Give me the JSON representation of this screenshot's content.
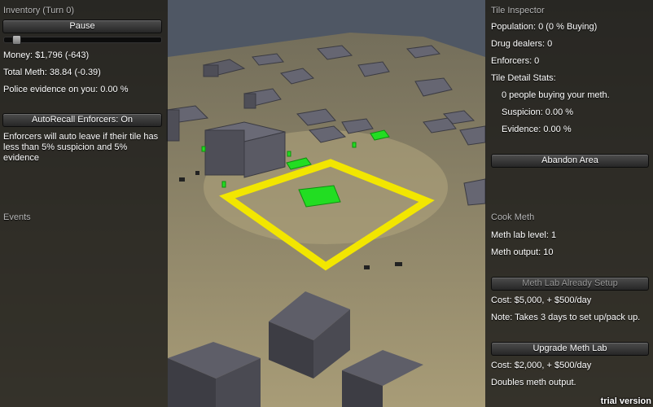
{
  "left": {
    "title": "Inventory (Turn 0)",
    "pause_label": "Pause",
    "money": "Money: $1,796 (-643)",
    "total_meth": "Total Meth: 38.84 (-0.39)",
    "police_evidence": "Police evidence on you: 0.00 %",
    "autorecall_label": "AutoRecall Enforcers: On",
    "autorecall_note": "Enforcers will auto leave if their tile has less than 5% suspicion and 5% evidence",
    "events_title": "Events",
    "speed_fraction": 0.05
  },
  "right": {
    "title": "Tile Inspector",
    "population": "Population: 0 (0 % Buying)",
    "drug_dealers": "Drug dealers: 0",
    "enforcers": "Enforcers: 0",
    "detail_title": "Tile Detail Stats:",
    "buying": "0 people buying your meth.",
    "suspicion": "Suspicion: 0.00 %",
    "evidence": "Evidence: 0.00 %",
    "abandon_label": "Abandon Area",
    "cook_title": "Cook Meth",
    "lab_level": "Meth lab level: 1",
    "lab_output": "Meth output: 10",
    "setup_label": "Meth Lab Already Setup",
    "setup_cost": "Cost: $5,000, + $500/day",
    "setup_note": "Note: Takes 3 days to set up/pack up.",
    "upgrade_label": "Upgrade Meth Lab",
    "upgrade_cost": "Cost: $2,000, + $500/day",
    "upgrade_note": "Doubles meth output."
  },
  "watermark": "trial version",
  "colors": {
    "selection": "#f2e600",
    "unit": "#22dd22",
    "ground": "#8f8566",
    "building": "#5c5c66"
  }
}
